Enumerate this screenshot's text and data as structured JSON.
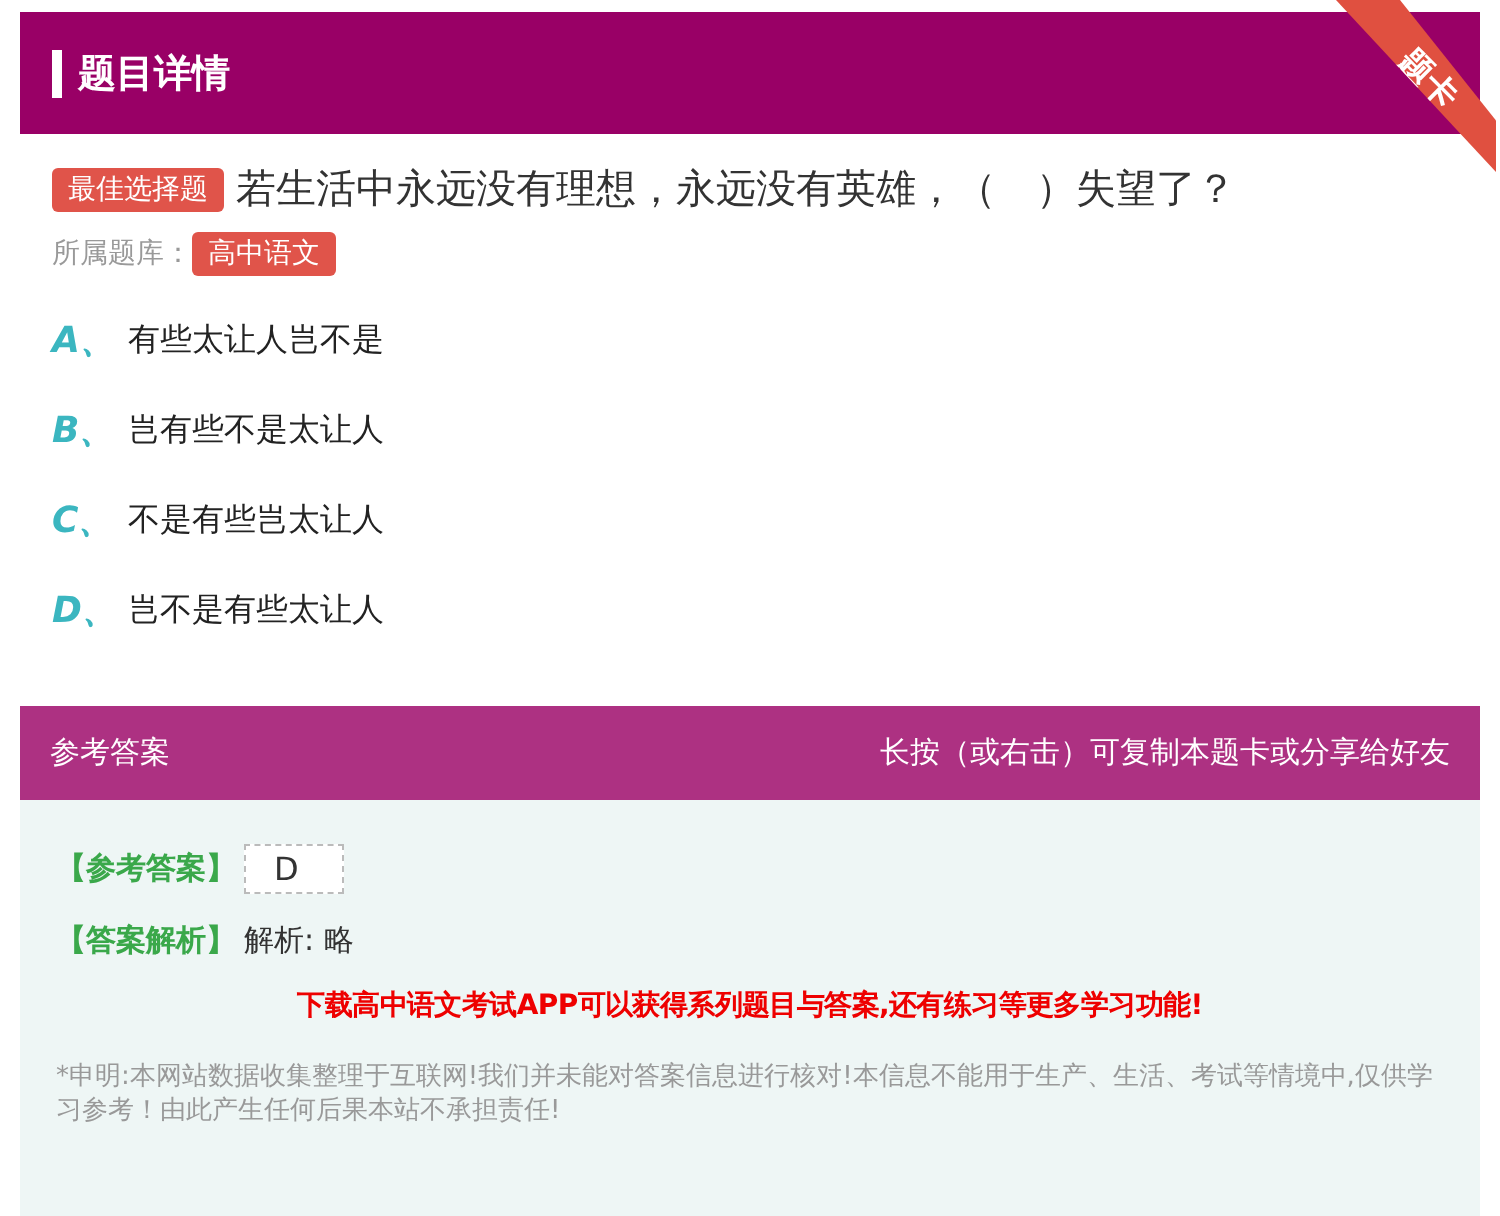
{
  "header": {
    "title": "题目详情",
    "ribbon": "题卡"
  },
  "question": {
    "type_badge": "最佳选择题",
    "text": "若生活中永远没有理想，永远没有英雄，（　）失望了？",
    "bank_label": "所属题库：",
    "bank": "高中语文"
  },
  "options": [
    {
      "letter": "A",
      "separator": "、",
      "text": "有些太让人岂不是"
    },
    {
      "letter": "B",
      "separator": "、",
      "text": "岂有些不是太让人"
    },
    {
      "letter": "C",
      "separator": "、",
      "text": "不是有些岂太让人"
    },
    {
      "letter": "D",
      "separator": "、",
      "text": "岂不是有些太让人"
    }
  ],
  "answer_panel": {
    "title": "参考答案",
    "hint": "长按（或右击）可复制本题卡或分享给好友",
    "answer_label": "【参考答案】",
    "answer": "D",
    "analysis_label": "【答案解析】",
    "analysis": "解析: 略",
    "promo": "下载高中语文考试APP可以获得系列题目与答案,还有练习等更多学习功能!",
    "disclaimer": "*申明:本网站数据收集整理于互联网!我们并未能对答案信息进行核对!本信息不能用于生产、生活、考试等情境中,仅供学习参考！由此产生任何后果本站不承担责任!"
  }
}
